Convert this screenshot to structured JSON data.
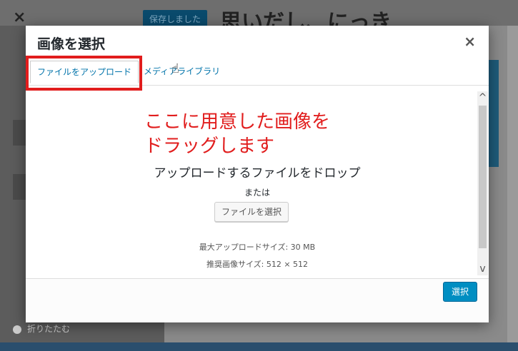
{
  "background": {
    "close_glyph": "×",
    "save_label": "保存しました",
    "site_title": "思いだし、にっき",
    "collapse_label": "折りたたむ"
  },
  "modal": {
    "title": "画像を選択",
    "close_glyph": "×",
    "tabs": [
      {
        "label": "ファイルをアップロード",
        "active": true
      },
      {
        "label": "メディアライブラリ",
        "active": false
      }
    ],
    "annotation_lines": [
      "ここに用意した画像を",
      "ドラッグします"
    ],
    "drop_text": "アップロードするファイルをドロップ",
    "or_text": "または",
    "select_file_label": "ファイルを選択",
    "max_upload": "最大アップロードサイズ: 30 MB",
    "recommended_size": "推奨画像サイズ: 512 × 512",
    "select_button_label": "選択",
    "scroll_up_glyph": "^",
    "scroll_down_glyph": "v"
  },
  "colors": {
    "accent": "#0073aa",
    "primary_button": "#008ec2",
    "annotation_red": "#e11d1d"
  },
  "icons": {
    "cursor": "hand-pointer-icon",
    "close": "close-icon"
  }
}
